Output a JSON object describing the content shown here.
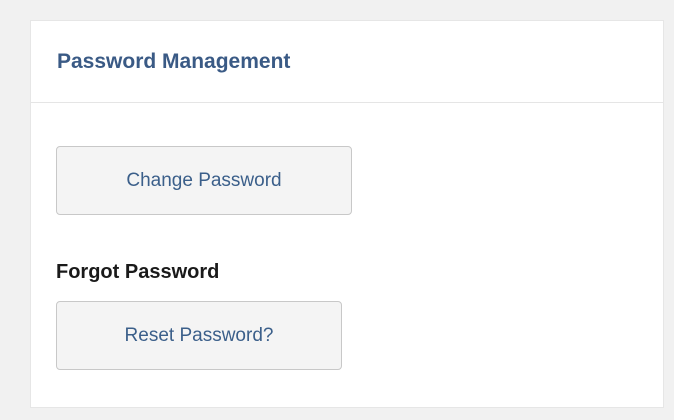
{
  "panel": {
    "title": "Password Management",
    "change_password_label": "Change Password",
    "forgot_password_heading": "Forgot Password",
    "reset_password_label": "Reset Password?"
  },
  "colors": {
    "title": "#3a5a85",
    "button_text": "#3b5f8a",
    "button_bg": "#f4f4f4",
    "heading": "#1a1a1a"
  }
}
